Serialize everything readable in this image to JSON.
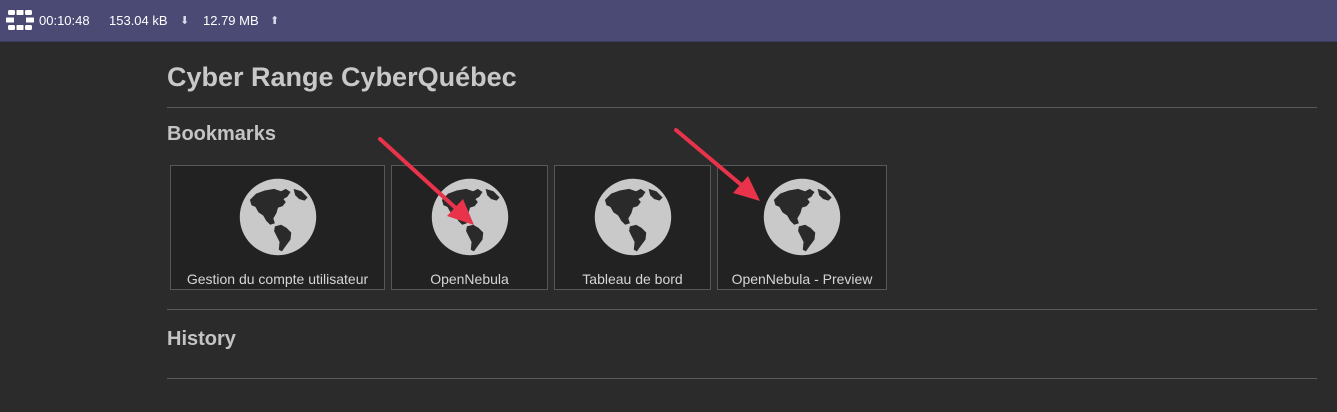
{
  "status_bar": {
    "session_time": "00:10:48",
    "download": "153.04 kB",
    "upload": "12.79 MB",
    "download_icon": "arrow-down-icon",
    "upload_icon": "arrow-up-icon",
    "logo_icon": "fortinet-logo-icon",
    "background": "#4a4a75"
  },
  "page": {
    "title": "Cyber Range CyberQuébec"
  },
  "bookmarks": {
    "heading": "Bookmarks",
    "items": [
      {
        "label": "Gestion du compte utilisateur",
        "icon": "globe-icon"
      },
      {
        "label": "OpenNebula",
        "icon": "globe-icon"
      },
      {
        "label": "Tableau de bord",
        "icon": "globe-icon"
      },
      {
        "label": "OpenNebula - Preview",
        "icon": "globe-icon"
      }
    ]
  },
  "history": {
    "heading": "History"
  },
  "annotations": {
    "arrow_color": "#e8334a",
    "arrow_icon": "red-arrow-annotation"
  }
}
